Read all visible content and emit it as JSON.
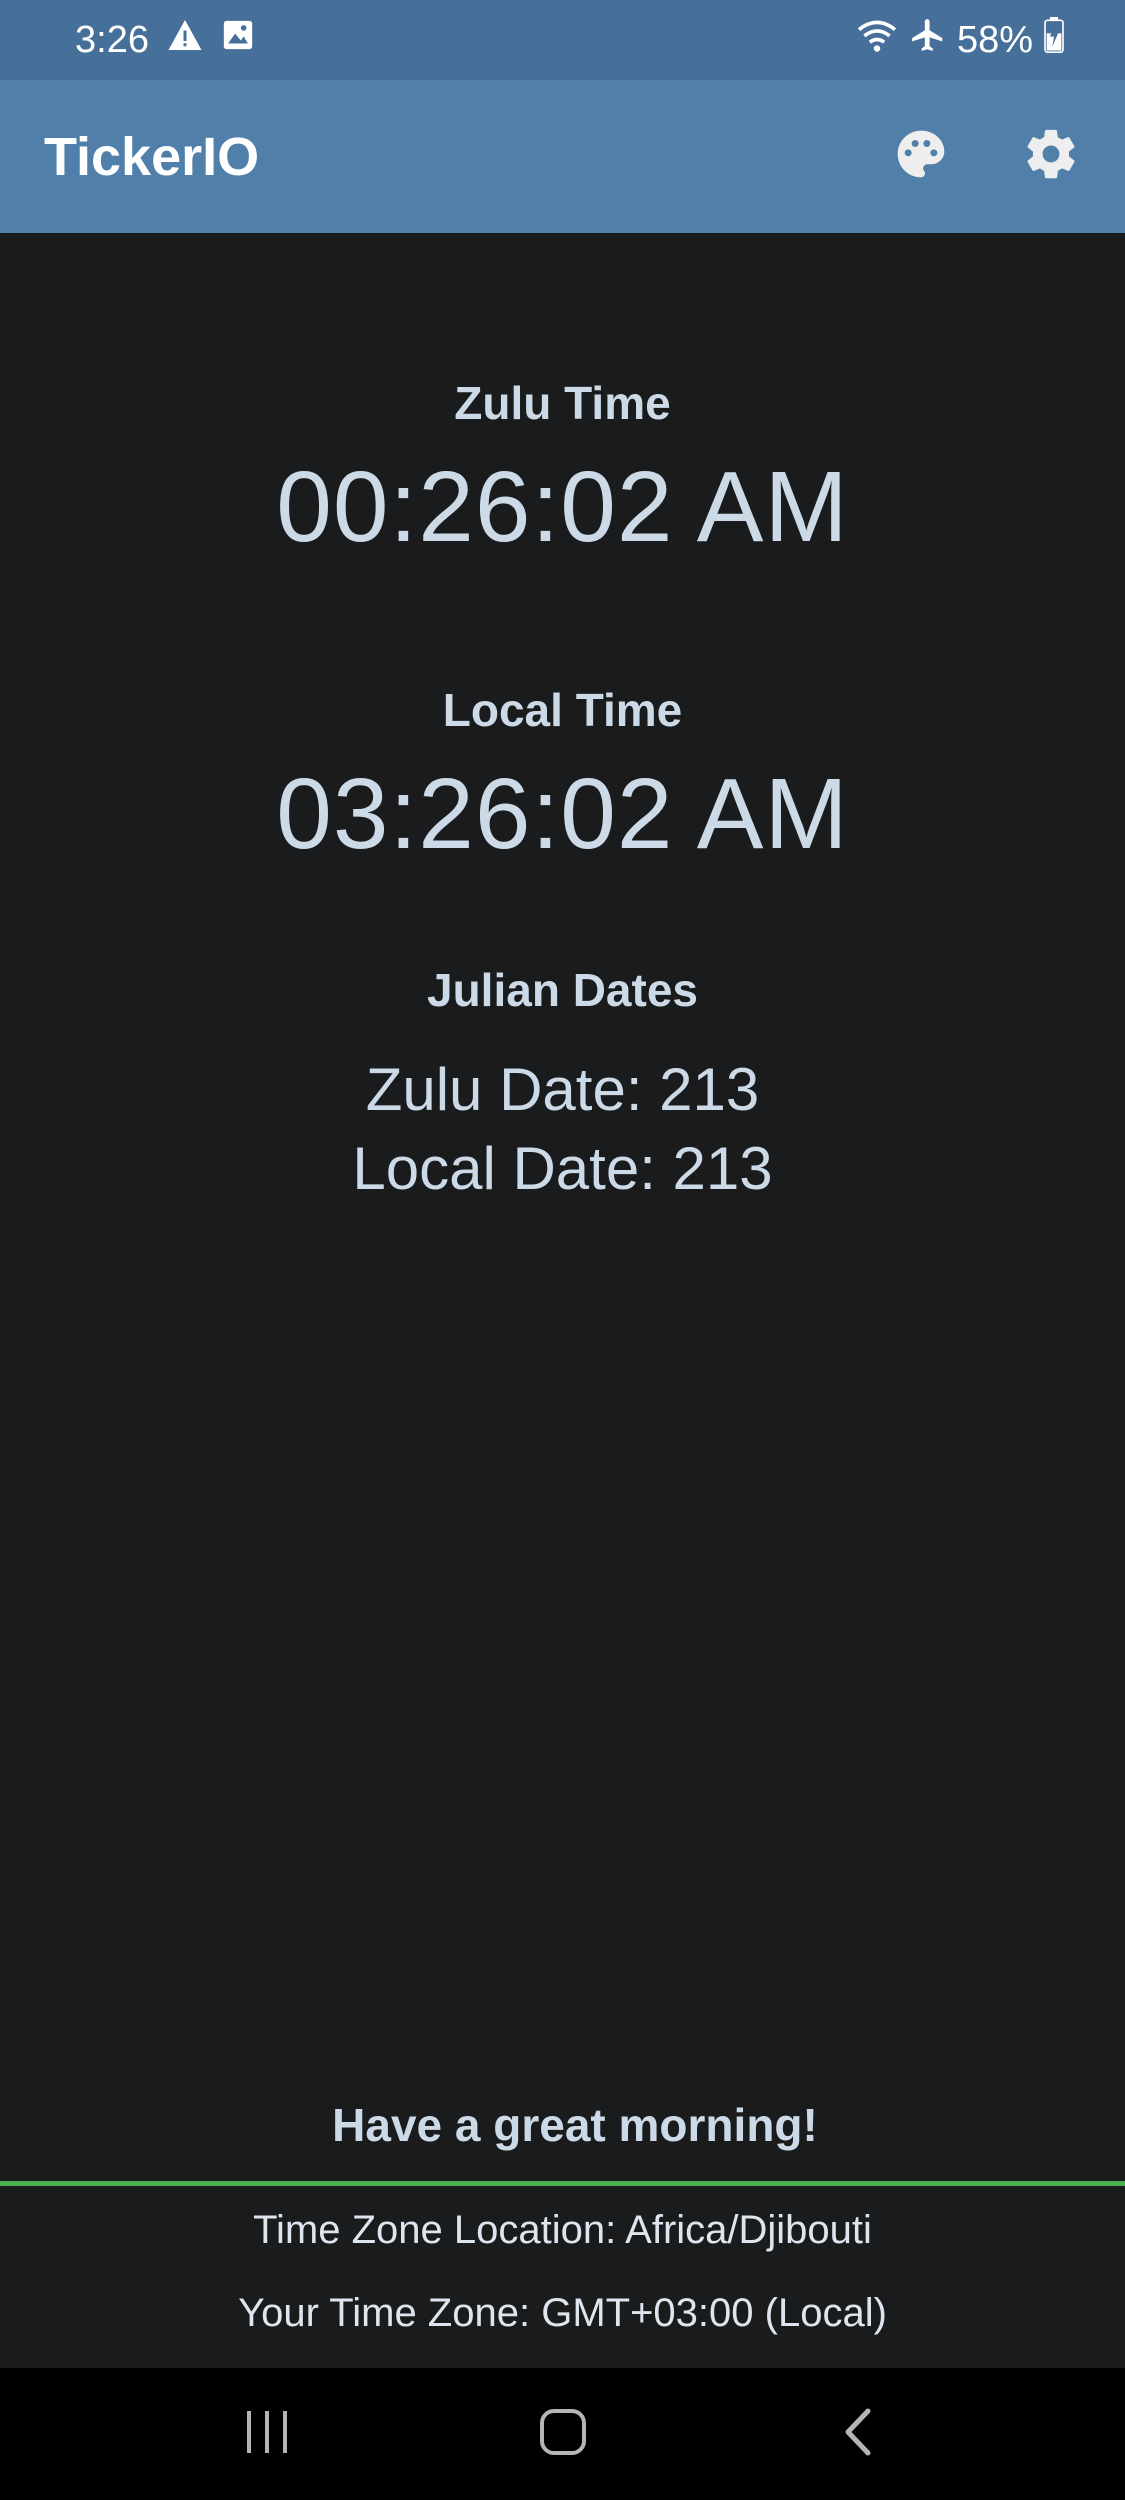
{
  "status_bar": {
    "time": "3:26",
    "battery": "58%",
    "icons": [
      "warning-icon",
      "image-icon",
      "wifi-icon",
      "airplane-icon",
      "battery-charging-icon"
    ]
  },
  "app_bar": {
    "title": "TickerIO",
    "actions": [
      "palette-icon",
      "settings-icon"
    ],
    "background": "#5080aa"
  },
  "zulu": {
    "label": "Zulu Time",
    "time": "00:26:02 AM"
  },
  "local": {
    "label": "Local Time",
    "time": "03:26:02 AM"
  },
  "julian": {
    "label": "Julian Dates",
    "zulu_date": "Zulu Date: 213",
    "local_date": "Local Date: 213"
  },
  "greeting": "Have a great morning!",
  "footer": {
    "tz_location": "Time Zone Location: Africa/Djibouti",
    "tz_offset": "Your Time Zone: GMT+03:00 (Local)",
    "divider_color": "#4caf50"
  },
  "nav_bar": {
    "buttons": [
      "recents-icon",
      "home-icon",
      "back-icon"
    ]
  }
}
